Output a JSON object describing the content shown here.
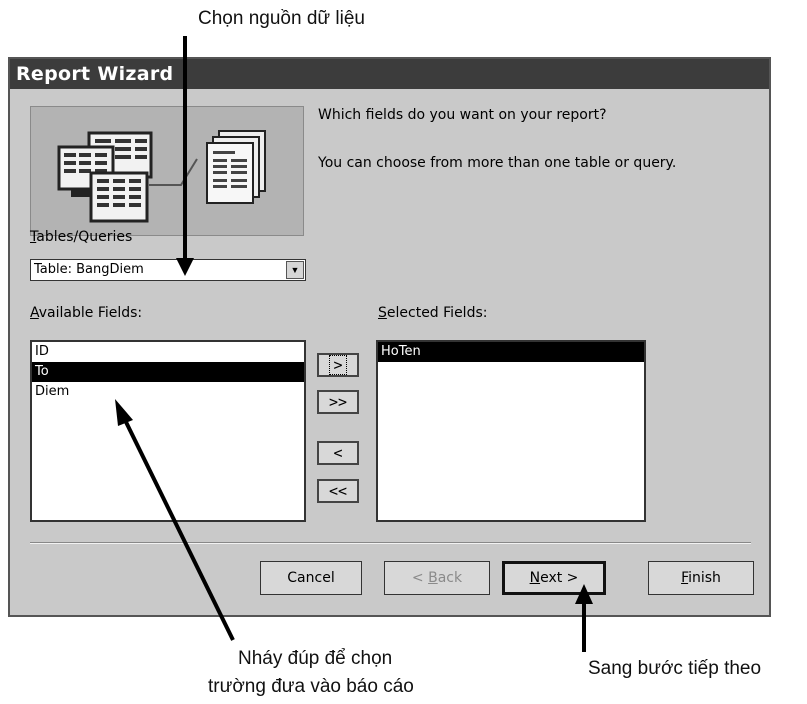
{
  "annotations": {
    "top": "Chọn nguồn dữ liệu",
    "bottom_left_line1": "Nháy đúp để chọn",
    "bottom_left_line2": "trường đưa vào báo cáo",
    "bottom_right": "Sang bước tiếp theo"
  },
  "window": {
    "title": "Report Wizard"
  },
  "prompt": {
    "line1": "Which fields do you want on your report?",
    "line2": "You can choose from more than one table or query."
  },
  "tables_queries": {
    "label_hotkey": "T",
    "label_rest": "ables/Queries",
    "value": "Table: BangDiem"
  },
  "available": {
    "label_hotkey": "A",
    "label_rest": "vailable Fields:",
    "items": [
      "ID",
      "To",
      "Diem"
    ],
    "selected_index": 1
  },
  "selected": {
    "label_hotkey": "S",
    "label_rest": "elected Fields:",
    "items": [
      "HoTen"
    ]
  },
  "move_buttons": {
    "add_one": ">",
    "add_all": ">>",
    "remove_one": "<",
    "remove_all": "<<"
  },
  "buttons": {
    "cancel": "Cancel",
    "back_pre": "< ",
    "back_hotkey": "B",
    "back_rest": "ack",
    "next_hotkey": "N",
    "next_rest": "ext >",
    "finish_hotkey": "F",
    "finish_rest": "inish"
  }
}
